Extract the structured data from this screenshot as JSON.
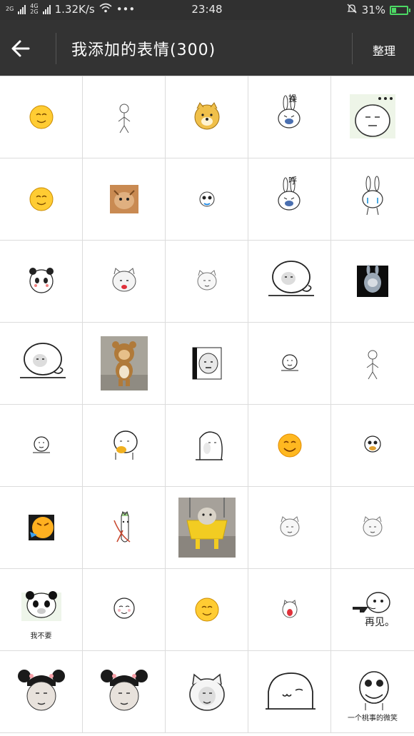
{
  "status_bar": {
    "net_1": "2G",
    "net_2a": "4G",
    "net_2b": "2G",
    "speed": "1.32K/s",
    "dots": "•••",
    "time": "23:48",
    "battery": "31%",
    "battery_level": 0.31,
    "colors": {
      "background": "#303030",
      "battery": "#4cd964"
    }
  },
  "header": {
    "title": "我添加的表情(300)",
    "manage_label": "整理",
    "back_icon": "arrow-left-icon",
    "colors": {
      "background": "#333333",
      "text": "#ffffff"
    }
  },
  "stickers": [
    {
      "icon": "yellow-face-sticker"
    },
    {
      "icon": "stick-figure-sticker"
    },
    {
      "icon": "doge-sticker"
    },
    {
      "icon": "rabbit-shouting-sticker",
      "text": "操"
    },
    {
      "icon": "speechless-face-sticker"
    },
    {
      "icon": "yellow-face-sticker"
    },
    {
      "icon": "cat-photo-sticker"
    },
    {
      "icon": "panda-small-sticker"
    },
    {
      "icon": "rabbit-shouting-sticker",
      "text": "呼"
    },
    {
      "icon": "crying-rabbit-sticker"
    },
    {
      "icon": "panda-face-sticker"
    },
    {
      "icon": "blush-cat-sticker"
    },
    {
      "icon": "small-cat-sticker"
    },
    {
      "icon": "lying-face-sticker"
    },
    {
      "icon": "rabbit-dark-sticker"
    },
    {
      "icon": "lying-face-sticker"
    },
    {
      "icon": "bear-photo-sticker"
    },
    {
      "icon": "bw-cat-sticker"
    },
    {
      "icon": "small-head-sticker"
    },
    {
      "icon": "stick-figure-sticker"
    },
    {
      "icon": "small-head-sticker"
    },
    {
      "icon": "tea-drinking-sticker"
    },
    {
      "icon": "peeking-head-sticker"
    },
    {
      "icon": "smile-emoji-sticker"
    },
    {
      "icon": "mouth-cover-sticker"
    },
    {
      "icon": "angry-emoji-sticker"
    },
    {
      "icon": "rope-figure-sticker"
    },
    {
      "icon": "cat-swing-sticker"
    },
    {
      "icon": "small-cat-sticker"
    },
    {
      "icon": "small-cat-sticker"
    },
    {
      "icon": "panda-meme-sticker",
      "text": "我不要"
    },
    {
      "icon": "smile-head-sticker"
    },
    {
      "icon": "yellow-face-sticker"
    },
    {
      "icon": "shocked-cat-sticker"
    },
    {
      "icon": "gun-figure-sticker",
      "text": "再见。"
    },
    {
      "icon": "girl-bun-sticker"
    },
    {
      "icon": "girl-bun-sticker"
    },
    {
      "icon": "big-cat-face-sticker"
    },
    {
      "icon": "big-smile-face-sticker"
    },
    {
      "icon": "laughing-face-sticker",
      "text": "一个桃事的微笑"
    }
  ]
}
